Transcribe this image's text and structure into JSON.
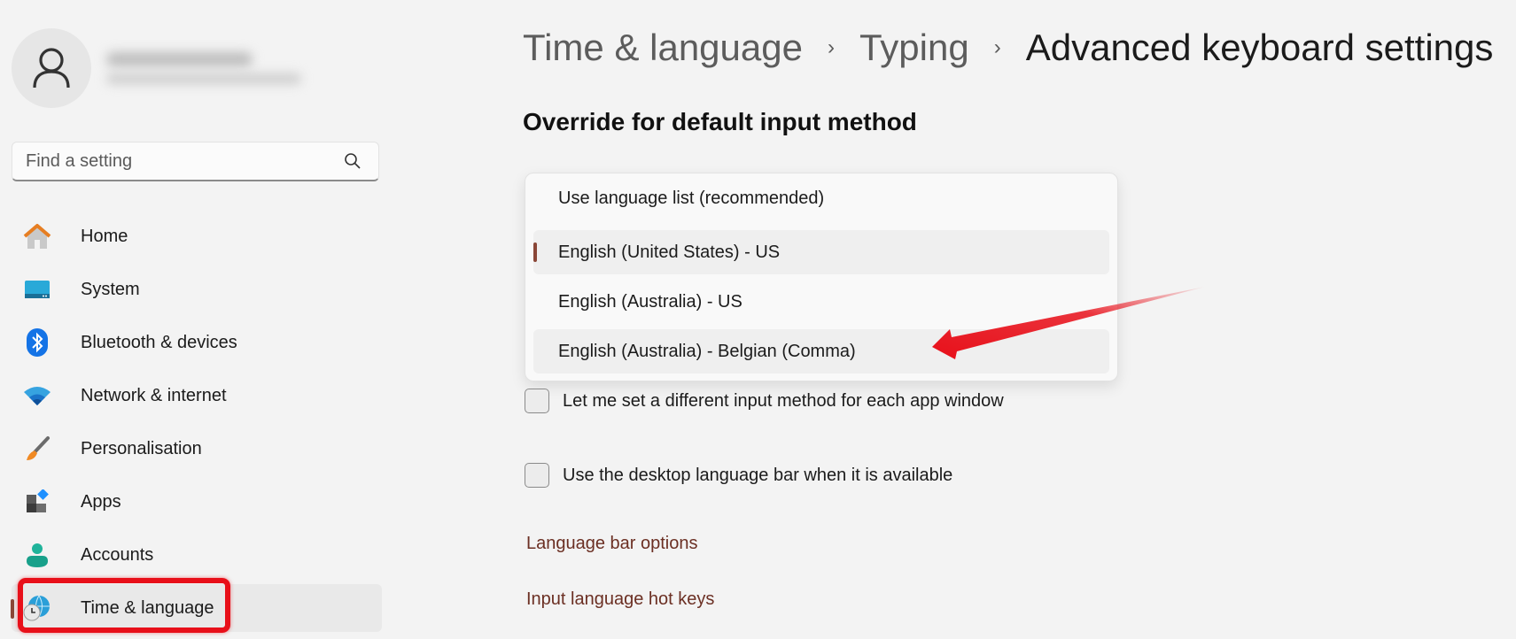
{
  "sidebar": {
    "search": {
      "placeholder": "Find a setting",
      "value": ""
    },
    "items": [
      {
        "label": "Home",
        "icon": "home-icon"
      },
      {
        "label": "System",
        "icon": "system-icon"
      },
      {
        "label": "Bluetooth & devices",
        "icon": "bluetooth-icon"
      },
      {
        "label": "Network & internet",
        "icon": "wifi-icon"
      },
      {
        "label": "Personalisation",
        "icon": "brush-icon"
      },
      {
        "label": "Apps",
        "icon": "apps-icon"
      },
      {
        "label": "Accounts",
        "icon": "accounts-icon"
      },
      {
        "label": "Time & language",
        "icon": "time-language-icon",
        "active": true
      }
    ],
    "accent_color": "#8a4637"
  },
  "breadcrumb": {
    "items": [
      "Time & language",
      "Typing"
    ],
    "current": "Advanced keyboard settings",
    "separator": "›"
  },
  "main": {
    "section_title": "Override for default input method",
    "dropdown": {
      "options": [
        {
          "label": "Use language list (recommended)"
        },
        {
          "label": "English (United States) - US",
          "selected": true
        },
        {
          "label": "English (Australia) - US"
        },
        {
          "label": "English (Australia) - Belgian (Comma)",
          "hovered": true
        }
      ]
    },
    "checkboxes": [
      {
        "label": "Let me set a different input method for each app window",
        "checked": false
      },
      {
        "label": "Use the desktop language bar when it is available",
        "checked": false
      }
    ],
    "links": [
      {
        "label": "Language bar options"
      },
      {
        "label": "Input language hot keys"
      }
    ],
    "link_color": "#6b2f23"
  },
  "annotations": {
    "highlight_color": "#e8101a",
    "arrow_color": "#e8101a"
  }
}
